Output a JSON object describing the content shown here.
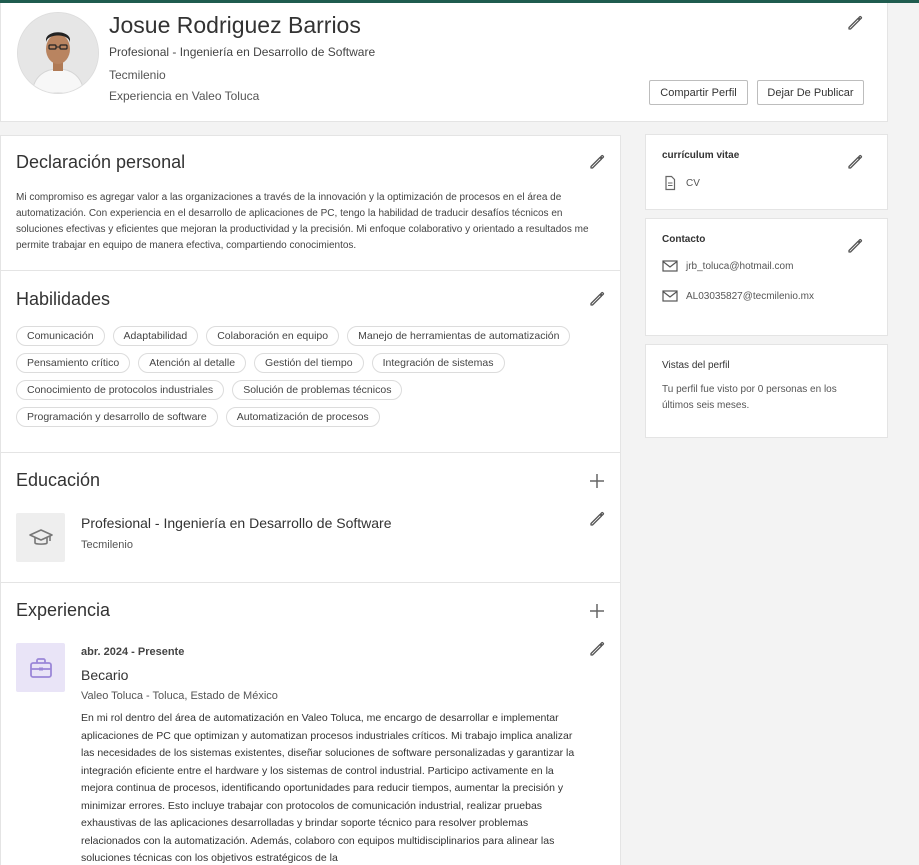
{
  "profile": {
    "name": "Josue Rodriguez Barrios",
    "degree": "Profesional - Ingeniería en Desarrollo de Software",
    "school": "Tecmilenio",
    "experience": "Experiencia en Valeo Toluca",
    "share_label": "Compartir Perfil",
    "unpublish_label": "Dejar De Publicar"
  },
  "statement": {
    "title": "Declaración personal",
    "text": "Mi compromiso es agregar valor a las organizaciones a través de la innovación y la optimización de procesos en el área de automatización. Con experiencia en el desarrollo de aplicaciones de PC, tengo la habilidad de traducir desafíos técnicos en soluciones efectivas y eficientes que mejoran la productividad y la precisión. Mi enfoque colaborativo y orientado a resultados me permite trabajar en equipo de manera efectiva, compartiendo conocimientos."
  },
  "skills": {
    "title": "Habilidades",
    "items": [
      "Comunicación",
      "Adaptabilidad",
      "Colaboración en equipo",
      "Manejo de herramientas de automatización",
      "Pensamiento crítico",
      "Atención al detalle",
      "Gestión del tiempo",
      "Integración de sistemas",
      "Conocimiento de protocolos industriales",
      "Solución de problemas técnicos",
      "Programación y desarrollo de software",
      "Automatización de procesos"
    ]
  },
  "education": {
    "title": "Educación",
    "degree": "Profesional - Ingeniería en Desarrollo de Software",
    "school": "Tecmilenio"
  },
  "experience": {
    "title": "Experiencia",
    "dates": "abr. 2024 - Presente",
    "role": "Becario",
    "company": "Valeo Toluca - Toluca, Estado de México",
    "description": "En mi rol dentro del área de automatización en Valeo Toluca, me encargo de desarrollar e implementar aplicaciones de PC que optimizan y automatizan procesos industriales críticos. Mi trabajo implica analizar las necesidades de los sistemas existentes, diseñar soluciones de software personalizadas y garantizar la integración eficiente entre el hardware y los sistemas de control industrial. Participo activamente en la mejora continua de procesos, identificando oportunidades para reducir tiempos, aumentar la precisión y minimizar errores. Esto incluye trabajar con protocolos de comunicación industrial, realizar pruebas exhaustivas de las aplicaciones desarrolladas y brindar soporte técnico para resolver problemas relacionados con la automatización. Además, colaboro con equipos multidisciplinarios para alinear las soluciones técnicas con los objetivos estratégicos de la"
  },
  "cv": {
    "title": "currículum vitae",
    "file_label": "CV"
  },
  "contact": {
    "title": "Contacto",
    "email_personal": "jrb_toluca@hotmail.com",
    "email_school": "AL03035827@tecmilenio.mx"
  },
  "views": {
    "title": "Vistas del perfil",
    "text": "Tu perfil fue visto por 0 personas en los últimos seis meses."
  },
  "colors": {
    "accent": "#1f5c4f",
    "experience_icon_bg": "#e9e4f7",
    "experience_icon": "#9b87d8",
    "education_icon_bg": "#eeeeee"
  }
}
